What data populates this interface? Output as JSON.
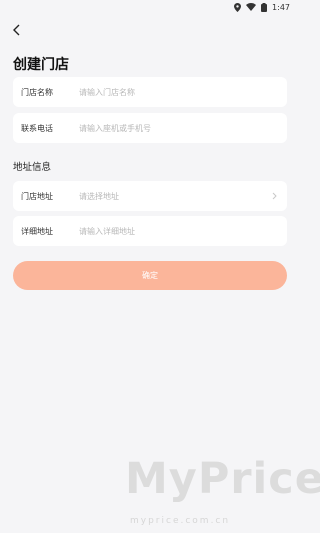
{
  "status_bar": {
    "time": "1:47",
    "icons": [
      "location-icon",
      "wifi-icon",
      "battery-icon"
    ]
  },
  "header": {
    "back_icon": "chevron-left-icon",
    "title": "创建门店"
  },
  "form": {
    "store_name": {
      "label": "门店名称",
      "placeholder": "请输入门店名称"
    },
    "phone": {
      "label": "联系电话",
      "placeholder": "请输入座机或手机号"
    }
  },
  "address_section": {
    "title": "地址信息",
    "store_address": {
      "label": "门店地址",
      "placeholder": "请选择地址",
      "icon": "chevron-right-icon"
    },
    "detail_address": {
      "label": "详细地址",
      "placeholder": "请输入详细地址"
    }
  },
  "confirm_button": {
    "label": "确定",
    "color": "#fbb59a"
  },
  "watermark": {
    "brand": "MyPrice",
    "url": "myprice.com.cn"
  }
}
